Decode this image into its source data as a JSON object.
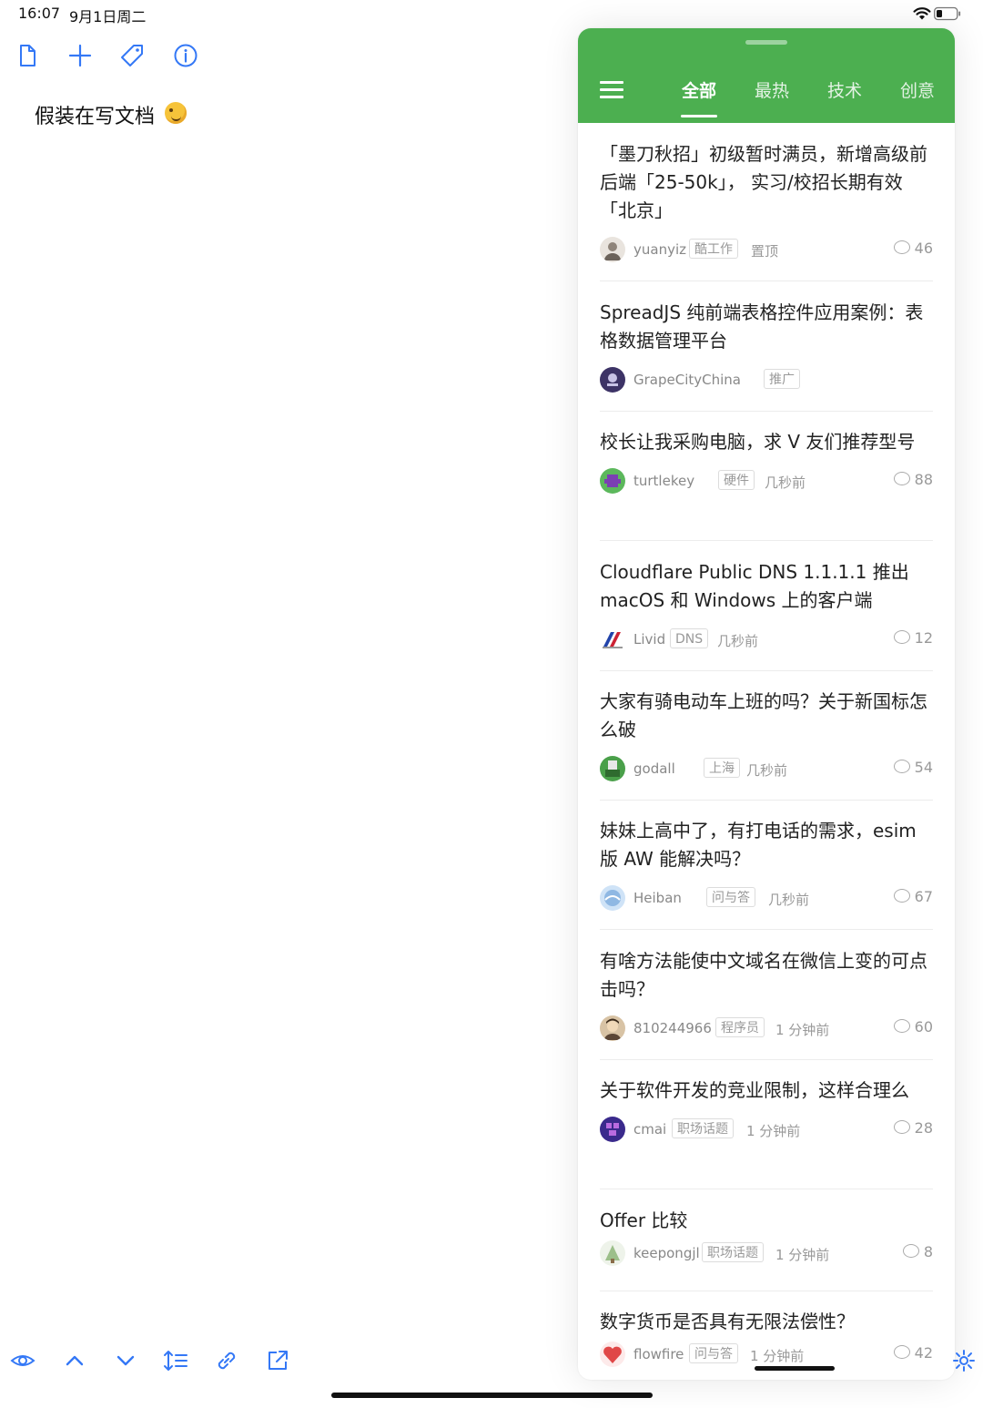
{
  "status": {
    "time": "16:07",
    "date": "9月1日周二"
  },
  "editor": {
    "doc_title": "假装在写文档"
  },
  "panel": {
    "tabs": [
      {
        "label": "全部",
        "active": true
      },
      {
        "label": "最热",
        "active": false
      },
      {
        "label": "技术",
        "active": false
      },
      {
        "label": "创意",
        "active": false
      }
    ],
    "topics": [
      {
        "title": "「墨刀秋招」初级暂时满员，新增高级前后端「25-50k」， 实习/校招长期有效「北京」",
        "author": "yuanyiz",
        "node": "酷工作",
        "time": "置顶",
        "replies": "46"
      },
      {
        "title": "SpreadJS 纯前端表格控件应用案例：表格数据管理平台",
        "author": "GrapeCityChina",
        "node": "推广",
        "time": "",
        "replies": ""
      },
      {
        "title": "校长让我采购电脑，求 V 友们推荐型号",
        "author": "turtlekey",
        "node": "硬件",
        "time": "几秒前",
        "replies": "88"
      },
      {
        "title": "Cloudflare Public DNS 1.1.1.1 推出 macOS 和 Windows 上的客户端",
        "author": "Livid",
        "node": "DNS",
        "time": "几秒前",
        "replies": "12"
      },
      {
        "title": "大家有骑电动车上班的吗？关于新国标怎么破",
        "author": "godall",
        "node": "上海",
        "time": "几秒前",
        "replies": "54"
      },
      {
        "title": "妹妹上高中了，有打电话的需求，esim 版 AW 能解决吗？",
        "author": "Heiban",
        "node": "问与答",
        "time": "几秒前",
        "replies": "67"
      },
      {
        "title": "有啥方法能使中文域名在微信上变的可点击吗？",
        "author": "810244966",
        "node": "程序员",
        "time": "1 分钟前",
        "replies": "60"
      },
      {
        "title": "关于软件开发的竞业限制，这样合理么",
        "author": "cmai",
        "node": "职场话题",
        "time": "1 分钟前",
        "replies": "28"
      },
      {
        "title": "Offer 比较",
        "author": "keepongjl",
        "node": "职场话题",
        "time": "1 分钟前",
        "replies": "8"
      },
      {
        "title": "数字货币是否具有无限法偿性？",
        "author": "flowfire",
        "node": "问与答",
        "time": "1 分钟前",
        "replies": "42"
      }
    ]
  },
  "colors": {
    "accent_blue": "#3478f6",
    "header_green": "#4caf50"
  },
  "icons": {
    "top_toolbar": [
      "document-icon",
      "plus-icon",
      "tag-icon",
      "info-icon"
    ],
    "bottom_toolbar": [
      "eye-icon",
      "chevron-up-icon",
      "chevron-down-icon",
      "line-spacing-icon",
      "link-icon",
      "share-icon",
      "gear-icon"
    ]
  }
}
